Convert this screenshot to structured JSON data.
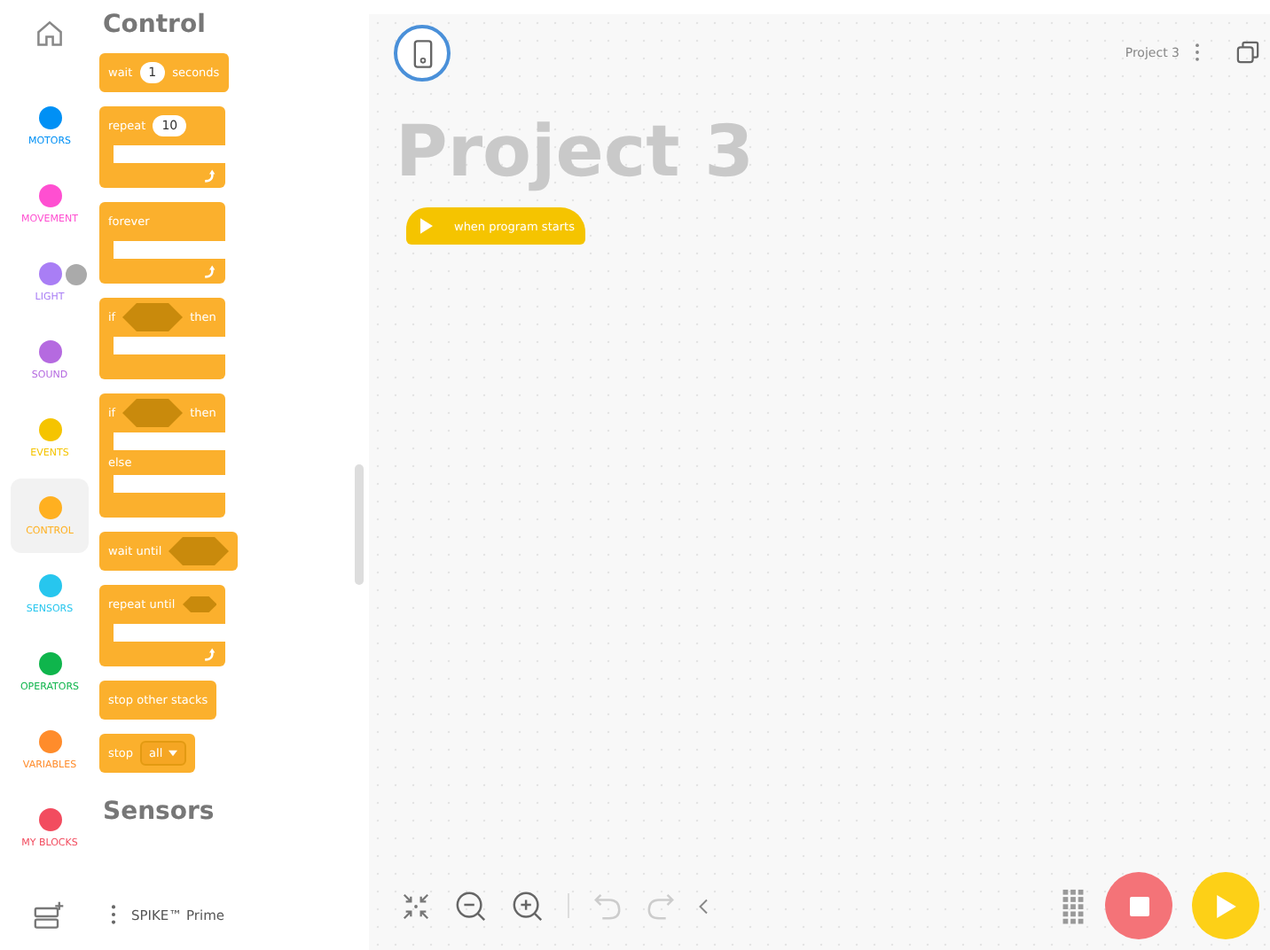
{
  "sidebar": {
    "categories": [
      {
        "label": "MOTORS",
        "color": "#0090f5",
        "selected": false
      },
      {
        "label": "MOVEMENT",
        "color": "#ff4fd1",
        "selected": false
      },
      {
        "label": "LIGHT",
        "color": "#a97ef5",
        "selected": false
      },
      {
        "label": "SOUND",
        "color": "#b56ae0",
        "selected": false
      },
      {
        "label": "EVENTS",
        "color": "#f5c400",
        "selected": false
      },
      {
        "label": "CONTROL",
        "color": "#ffb020",
        "selected": true
      },
      {
        "label": "SENSORS",
        "color": "#27c6ee",
        "selected": false
      },
      {
        "label": "OPERATORS",
        "color": "#0fb54c",
        "selected": false
      },
      {
        "label": "VARIABLES",
        "color": "#ff8c2b",
        "selected": false
      },
      {
        "label": "MY BLOCKS",
        "color": "#f24c5f",
        "selected": false
      }
    ],
    "hub_label": "SPIKE™ Prime"
  },
  "palette": {
    "heading": "Control",
    "next_heading": "Sensors",
    "blocks": [
      {
        "kind": "simple",
        "parts": [
          {
            "kind": "text",
            "text": "wait"
          },
          {
            "kind": "number",
            "text": "1"
          },
          {
            "kind": "text",
            "text": "seconds"
          }
        ]
      },
      {
        "kind": "c",
        "loop": true,
        "parts": [
          {
            "kind": "text",
            "text": "repeat"
          },
          {
            "kind": "number",
            "text": "10"
          }
        ]
      },
      {
        "kind": "c",
        "loop": true,
        "parts": [
          {
            "kind": "text",
            "text": "forever"
          }
        ]
      },
      {
        "kind": "c",
        "loop": false,
        "parts": [
          {
            "kind": "text",
            "text": "if"
          },
          {
            "kind": "hex"
          },
          {
            "kind": "text",
            "text": "then"
          }
        ]
      },
      {
        "kind": "ifelse",
        "loop": false,
        "else_label": "else",
        "parts": [
          {
            "kind": "text",
            "text": "if"
          },
          {
            "kind": "hex"
          },
          {
            "kind": "text",
            "text": "then"
          }
        ]
      },
      {
        "kind": "simple",
        "parts": [
          {
            "kind": "text",
            "text": "wait until"
          },
          {
            "kind": "hex"
          }
        ]
      },
      {
        "kind": "c",
        "loop": true,
        "parts": [
          {
            "kind": "text",
            "text": "repeat until"
          },
          {
            "kind": "hex"
          }
        ]
      },
      {
        "kind": "simple",
        "parts": [
          {
            "kind": "text",
            "text": "stop other stacks"
          }
        ]
      },
      {
        "kind": "simple",
        "parts": [
          {
            "kind": "text",
            "text": "stop"
          },
          {
            "kind": "dropdown",
            "text": "all"
          }
        ]
      }
    ]
  },
  "canvas": {
    "project_name": "Project 3",
    "title": "Project 3",
    "hat_block": {
      "label": "when program starts"
    }
  }
}
